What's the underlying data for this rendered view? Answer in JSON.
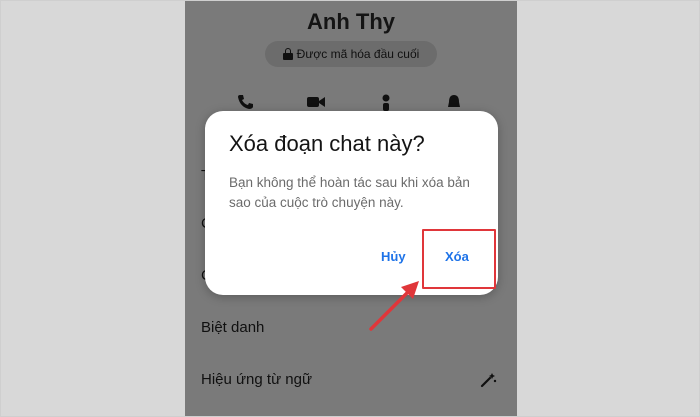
{
  "chat": {
    "contact_name": "Anh Thy",
    "encryption_label": "Được mã hóa đầu cuối",
    "actions": [
      "phone-icon",
      "video-call-icon",
      "profile-icon",
      "bell-icon"
    ],
    "menu_items": {
      "nickname": "Biệt danh",
      "word_effects": "Hiệu ứng từ ngữ"
    }
  },
  "dialog": {
    "title": "Xóa đoạn chat này?",
    "message": "Bạn không thể hoàn tác sau khi xóa bản sao của cuộc trò chuyện này.",
    "cancel_label": "Hủy",
    "delete_label": "Xóa"
  },
  "annotation": {
    "highlight_color": "#e0363a",
    "accent_color": "#1e73e8"
  }
}
